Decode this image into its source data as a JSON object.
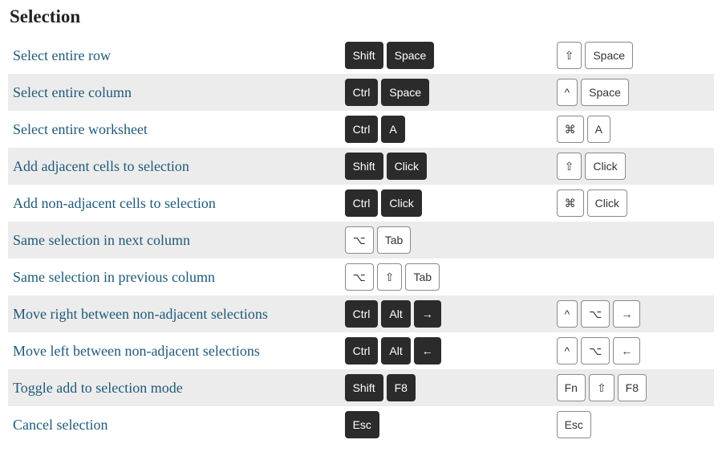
{
  "section_title": "Selection",
  "rows": [
    {
      "action": "Select entire row",
      "win": [
        {
          "t": "Shift",
          "s": "dark"
        },
        {
          "t": "Space",
          "s": "dark"
        }
      ],
      "mac": [
        {
          "t": "⇧",
          "s": "light"
        },
        {
          "t": "Space",
          "s": "light"
        }
      ]
    },
    {
      "action": "Select entire column",
      "win": [
        {
          "t": "Ctrl",
          "s": "dark"
        },
        {
          "t": "Space",
          "s": "dark"
        }
      ],
      "mac": [
        {
          "t": "^",
          "s": "light"
        },
        {
          "t": "Space",
          "s": "light"
        }
      ]
    },
    {
      "action": "Select entire worksheet",
      "win": [
        {
          "t": "Ctrl",
          "s": "dark"
        },
        {
          "t": "A",
          "s": "dark"
        }
      ],
      "mac": [
        {
          "t": "⌘",
          "s": "light"
        },
        {
          "t": "A",
          "s": "light"
        }
      ]
    },
    {
      "action": "Add adjacent cells to selection",
      "win": [
        {
          "t": "Shift",
          "s": "dark"
        },
        {
          "t": "Click",
          "s": "dark"
        }
      ],
      "mac": [
        {
          "t": "⇧",
          "s": "light"
        },
        {
          "t": "Click",
          "s": "light"
        }
      ]
    },
    {
      "action": "Add non-adjacent cells to selection",
      "win": [
        {
          "t": "Ctrl",
          "s": "dark"
        },
        {
          "t": "Click",
          "s": "dark"
        }
      ],
      "mac": [
        {
          "t": "⌘",
          "s": "light"
        },
        {
          "t": "Click",
          "s": "light"
        }
      ]
    },
    {
      "action": "Same selection in next column",
      "win": [
        {
          "t": "⌥",
          "s": "light"
        },
        {
          "t": "Tab",
          "s": "light"
        }
      ],
      "mac": []
    },
    {
      "action": "Same selection in previous column",
      "win": [
        {
          "t": "⌥",
          "s": "light"
        },
        {
          "t": "⇧",
          "s": "light"
        },
        {
          "t": "Tab",
          "s": "light"
        }
      ],
      "mac": []
    },
    {
      "action": "Move right between non-adjacent selections",
      "win": [
        {
          "t": "Ctrl",
          "s": "dark"
        },
        {
          "t": "Alt",
          "s": "dark"
        },
        {
          "t": "→",
          "s": "dark"
        }
      ],
      "mac": [
        {
          "t": "^",
          "s": "light"
        },
        {
          "t": "⌥",
          "s": "light"
        },
        {
          "t": "→",
          "s": "light"
        }
      ]
    },
    {
      "action": "Move left between non-adjacent selections",
      "win": [
        {
          "t": "Ctrl",
          "s": "dark"
        },
        {
          "t": "Alt",
          "s": "dark"
        },
        {
          "t": "←",
          "s": "dark"
        }
      ],
      "mac": [
        {
          "t": "^",
          "s": "light"
        },
        {
          "t": "⌥",
          "s": "light"
        },
        {
          "t": "←",
          "s": "light"
        }
      ]
    },
    {
      "action": "Toggle add to selection mode",
      "win": [
        {
          "t": "Shift",
          "s": "dark"
        },
        {
          "t": "F8",
          "s": "dark"
        }
      ],
      "mac": [
        {
          "t": "Fn",
          "s": "light"
        },
        {
          "t": "⇧",
          "s": "light"
        },
        {
          "t": "F8",
          "s": "light"
        }
      ]
    },
    {
      "action": "Cancel selection",
      "win": [
        {
          "t": "Esc",
          "s": "dark"
        }
      ],
      "mac": [
        {
          "t": "Esc",
          "s": "light"
        }
      ]
    }
  ]
}
